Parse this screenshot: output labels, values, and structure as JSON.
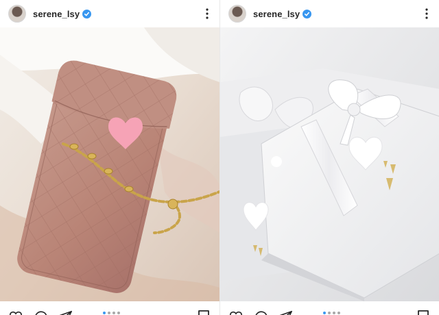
{
  "posts": [
    {
      "username": "serene_lsy",
      "photo_alt": "Pink quilted phone pouch with gold chain",
      "carousel_active_index": 0,
      "carousel_total": 4
    },
    {
      "username": "serene_lsy",
      "photo_alt": "White gift boxes with white ribbon",
      "carousel_active_index": 0,
      "carousel_total": 4
    }
  ],
  "icons": {
    "more": "more-options-icon",
    "verified": "verified-badge-icon",
    "like": "heart-icon",
    "comment": "comment-icon",
    "share": "paper-plane-icon",
    "save": "bookmark-icon"
  },
  "colors": {
    "verified_blue": "#3897f0",
    "text": "#262626",
    "heart_sticker_pink": "#f6a3b6"
  }
}
